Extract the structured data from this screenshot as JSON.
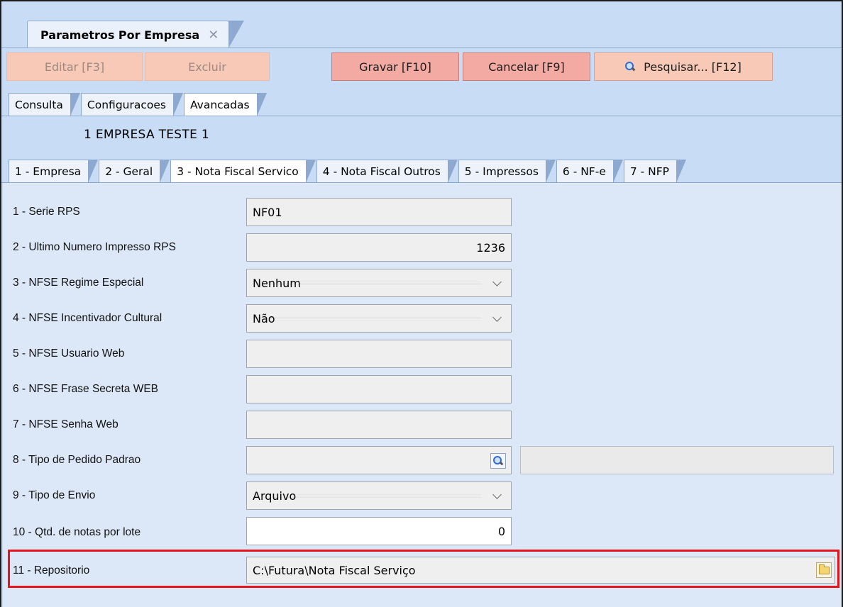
{
  "window": {
    "title": "Parametros Por Empresa",
    "close_glyph": "✕"
  },
  "toolbar": {
    "edit_label": "Editar [F3]",
    "delete_label": "Excluir",
    "save_label": "Gravar [F10]",
    "cancel_label": "Cancelar [F9]",
    "search_label": "Pesquisar... [F12]",
    "search_icon": "magnifier-icon"
  },
  "main_tabs": [
    {
      "label": "Consulta"
    },
    {
      "label": "Configuracoes"
    },
    {
      "label": "Avancadas"
    }
  ],
  "company": "1  EMPRESA TESTE 1",
  "sub_tabs": [
    {
      "label": "1 - Empresa"
    },
    {
      "label": "2 - Geral"
    },
    {
      "label": "3 - Nota Fiscal Servico"
    },
    {
      "label": "4 - Nota Fiscal Outros"
    },
    {
      "label": "5 - Impressos"
    },
    {
      "label": "6 - NF-e"
    },
    {
      "label": "7 - NFP"
    }
  ],
  "fields": {
    "serie_rps": {
      "label": "1 - Serie RPS",
      "value": "NF01"
    },
    "ultimo_numero": {
      "label": "2 - Ultimo Numero Impresso RPS",
      "value": "1236"
    },
    "regime_especial": {
      "label": "3 - NFSE Regime Especial",
      "value": "Nenhum"
    },
    "incentivador": {
      "label": "4 - NFSE Incentivador Cultural",
      "value": "Não"
    },
    "usuario_web": {
      "label": "5 - NFSE Usuario Web",
      "value": ""
    },
    "frase_secreta": {
      "label": "6 - NFSE Frase Secreta WEB",
      "value": ""
    },
    "senha_web": {
      "label": "7 - NFSE Senha Web",
      "value": ""
    },
    "tipo_pedido": {
      "label": "8 - Tipo de Pedido Padrao",
      "value": ""
    },
    "tipo_envio": {
      "label": "9 - Tipo de Envio",
      "value": "Arquivo"
    },
    "qtd_notas": {
      "label": "10 - Qtd. de notas por lote",
      "value": "0"
    },
    "repositorio": {
      "label": "11 - Repositorio",
      "value": "C:\\Futura\\Nota Fiscal Serviço"
    }
  },
  "colors": {
    "highlight": "#e8141c",
    "background": "#c9dcf6",
    "button_red": "#f3aaa3",
    "button_disabled": "#f8c9b6"
  }
}
